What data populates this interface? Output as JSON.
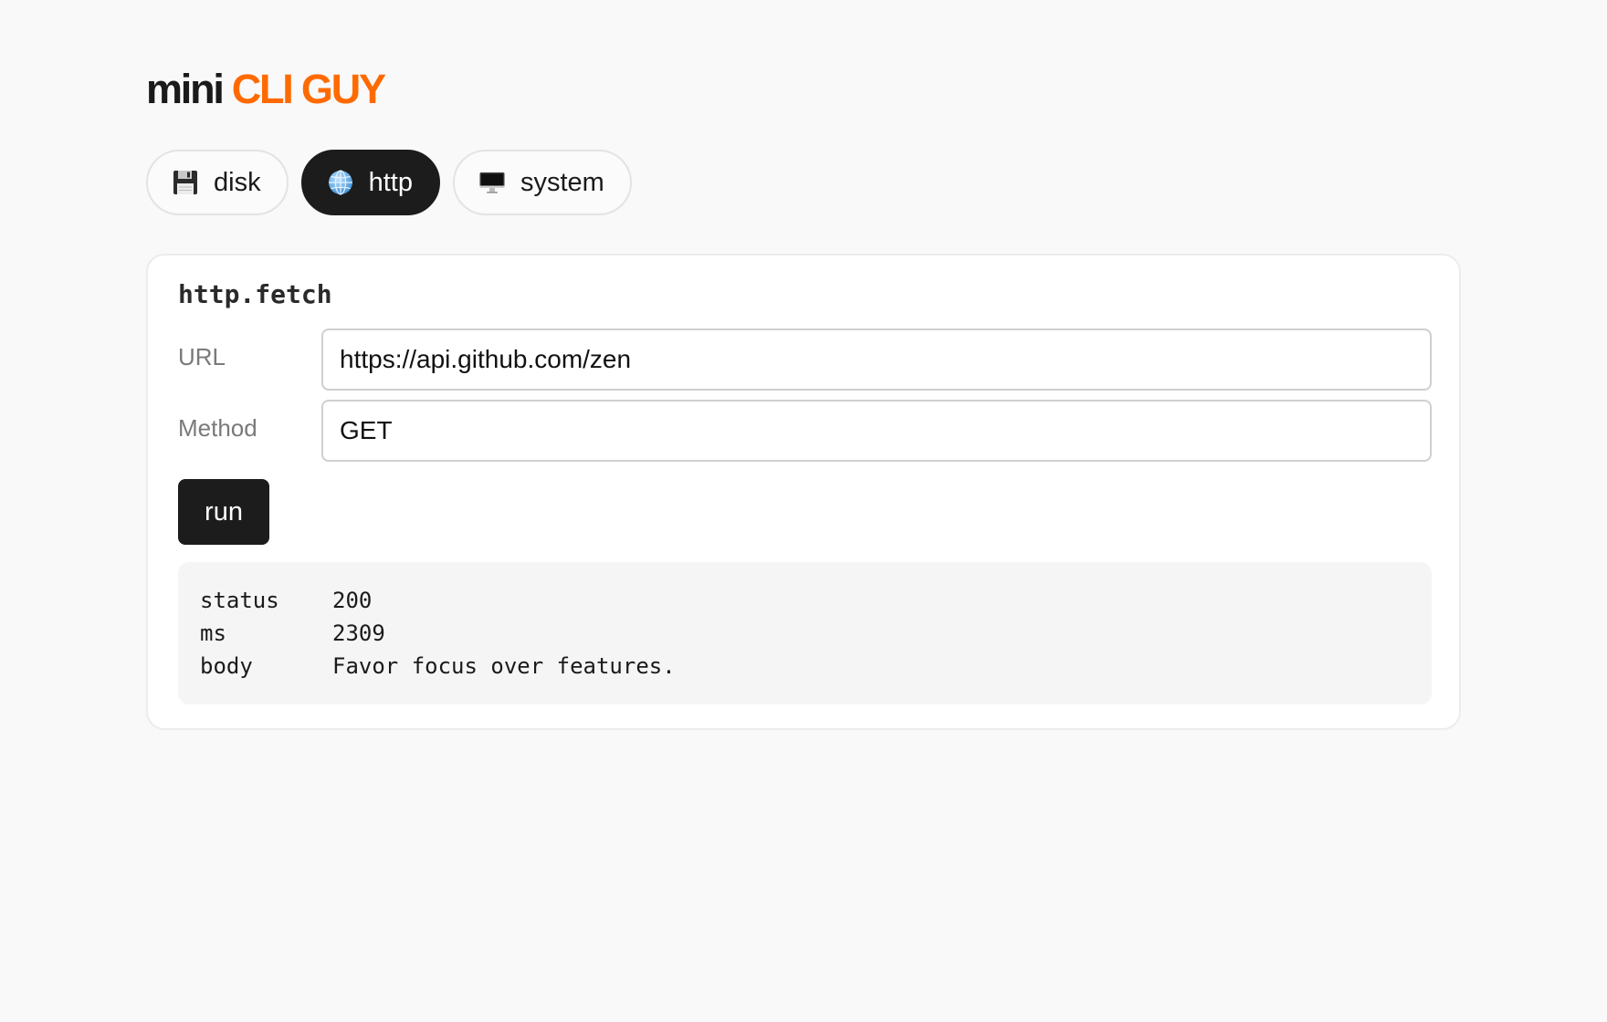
{
  "app": {
    "logo_part1": "mini",
    "logo_part2": "CLI GUY",
    "accent_color": "#ff6a00"
  },
  "tabs": [
    {
      "label": "disk",
      "icon": "floppy-disk-icon",
      "active": false
    },
    {
      "label": "http",
      "icon": "globe-icon",
      "active": true
    },
    {
      "label": "system",
      "icon": "desktop-computer-icon",
      "active": false
    }
  ],
  "panel": {
    "title": "http.fetch",
    "url_label": "URL",
    "url_value": "https://api.github.com/zen",
    "method_label": "Method",
    "method_value": "GET",
    "run_label": "run"
  },
  "output": [
    {
      "key": "status",
      "value": "200"
    },
    {
      "key": "ms",
      "value": "2309"
    },
    {
      "key": "body",
      "value": "Favor focus over features."
    }
  ]
}
